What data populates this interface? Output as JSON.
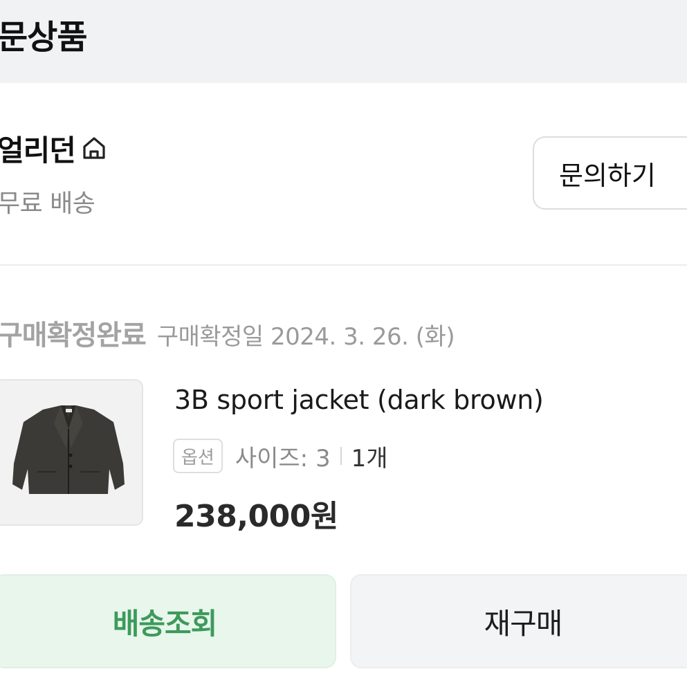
{
  "header": {
    "title": "문상품"
  },
  "seller": {
    "name": "얼리던",
    "shipping": "무료 배송",
    "inquiry_label": "문의하기"
  },
  "order": {
    "status": "구매확정완료",
    "confirm_date": "구매확정일 2024. 3. 26. (화)"
  },
  "product": {
    "name": "3B sport jacket (dark brown)",
    "option_badge": "옵션",
    "option_size": "사이즈: 3",
    "quantity": "1개",
    "price": "238,000원"
  },
  "actions": {
    "tracking_label": "배송조회",
    "reorder_label": "재구매"
  },
  "colors": {
    "tracking_text": "#3d9a5b",
    "tracking_bg": "#e8f6ec",
    "header_bg": "#f1f2f4"
  },
  "icons": {
    "store": "home-icon",
    "product": "jacket-thumbnail"
  }
}
